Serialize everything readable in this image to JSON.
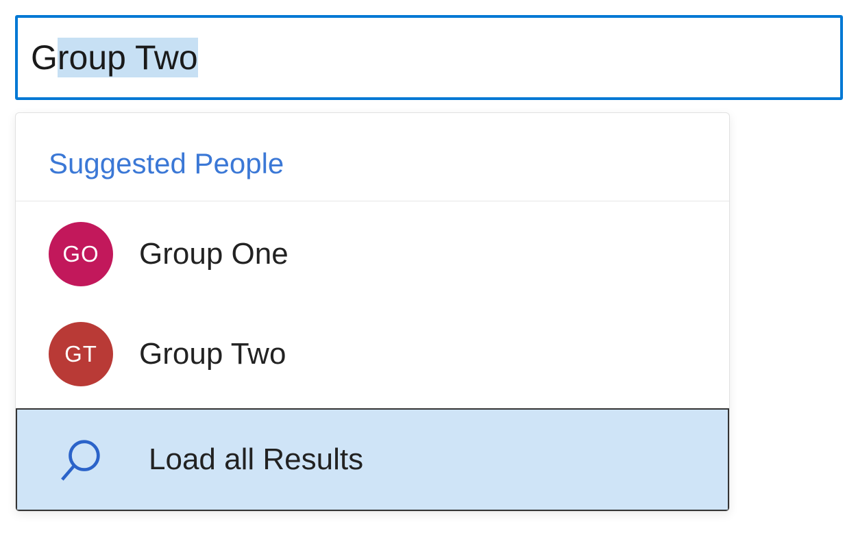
{
  "search": {
    "prefix": "G",
    "selected": "roup Two"
  },
  "dropdown": {
    "header": "Suggested People",
    "people": [
      {
        "initials": "GO",
        "name": "Group One",
        "avatar_color": "#c2185b"
      },
      {
        "initials": "GT",
        "name": "Group Two",
        "avatar_color": "#b93a36"
      }
    ],
    "load_all_label": "Load all Results"
  }
}
